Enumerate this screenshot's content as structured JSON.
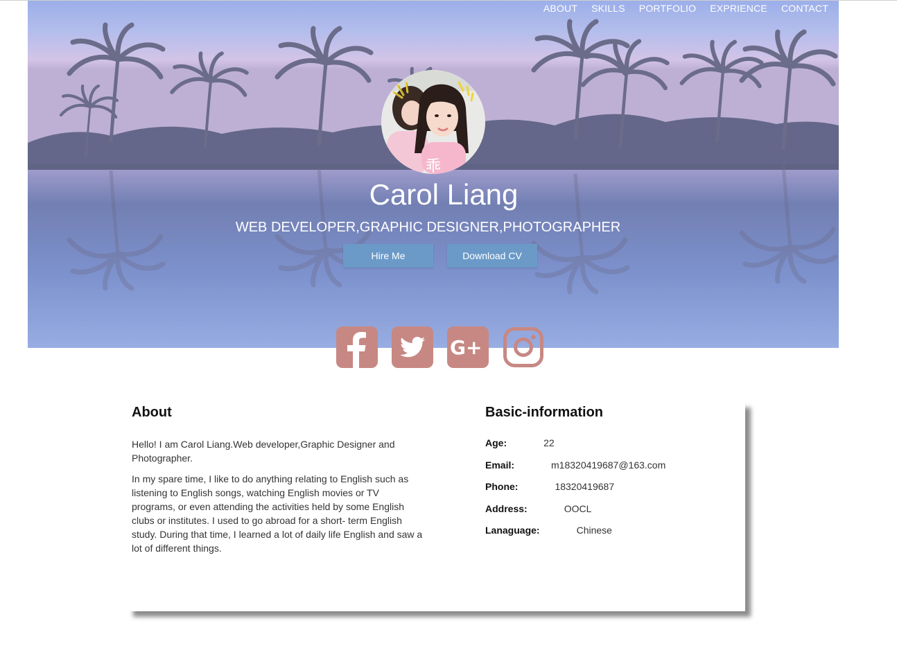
{
  "nav": {
    "items": [
      "ABOUT",
      "SKILLS",
      "PORTFOLIO",
      "EXPRIENCE",
      "CONTACT"
    ]
  },
  "hero": {
    "name": "Carol Liang",
    "subtitle": "WEB DEVELOPER,GRAPHIC DESIGNER,PHOTOGRAPHER",
    "hire_label": "Hire Me",
    "cv_label": "Download CV",
    "avatar_caption": "乖"
  },
  "social": {
    "icons": [
      "facebook-icon",
      "twitter-icon",
      "google-plus-icon",
      "instagram-icon"
    ],
    "google_text": "G+",
    "color": "#c78883"
  },
  "about": {
    "title": "About",
    "paragraphs": [
      "Hello! I am Carol Liang.Web developer,Graphic Designer and Photographer.",
      "In my spare time, I like to do anything relating to English such as listening to English songs, watching English movies or TV programs, or even attending the activities held by some English clubs or institutes. I used to go abroad for a short- term English study. During that time, I learned a lot of daily life English and saw a lot of different things."
    ]
  },
  "basic": {
    "title": "Basic-information",
    "rows": [
      {
        "label": "Age:",
        "value": "22"
      },
      {
        "label": "Email:",
        "value": "m18320419687@163.com"
      },
      {
        "label": "Phone:",
        "value": "18320419687"
      },
      {
        "label": "Address:",
        "value": "OOCL"
      },
      {
        "label": "Lanaguage:",
        "value": "Chinese"
      }
    ]
  },
  "colors": {
    "button": "#6b9ac8",
    "social": "#c78883"
  }
}
